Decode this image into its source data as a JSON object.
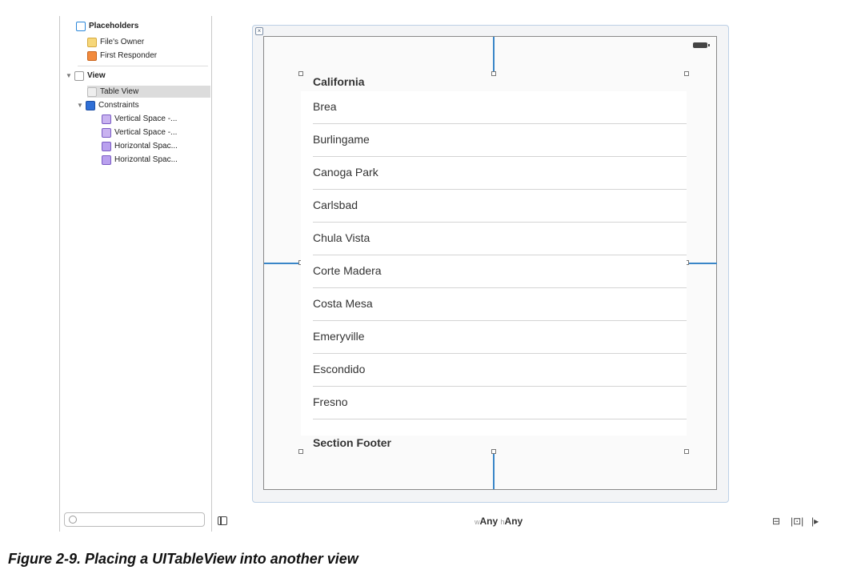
{
  "outline": {
    "placeholders": "Placeholders",
    "files_owner": "File's Owner",
    "first_responder": "First Responder",
    "view": "View",
    "table_view": "Table View",
    "constraints": "Constraints",
    "constraint_items": [
      "Vertical Space -...",
      "Vertical Space -...",
      "Horizontal Spac...",
      "Horizontal Spac..."
    ]
  },
  "table": {
    "header": "California",
    "rows": [
      "Brea",
      "Burlingame",
      "Canoga Park",
      "Carlsbad",
      "Chula Vista",
      "Corte Madera",
      "Costa Mesa",
      "Emeryville",
      "Escondido",
      "Fresno"
    ],
    "footer": "Section Footer"
  },
  "bottom_bar": {
    "w_prefix": "w",
    "w_value": "Any",
    "h_prefix": "h",
    "h_value": "Any",
    "tool_align": "⊟",
    "tool_pin": "|⊡|",
    "tool_resolve": "|▸"
  },
  "caption": {
    "number": "Figure 2-9.",
    "text": "Placing a UITableView into another view"
  },
  "icons": {
    "filter": "filter-icon",
    "panel_toggle": "panel-toggle-icon"
  }
}
